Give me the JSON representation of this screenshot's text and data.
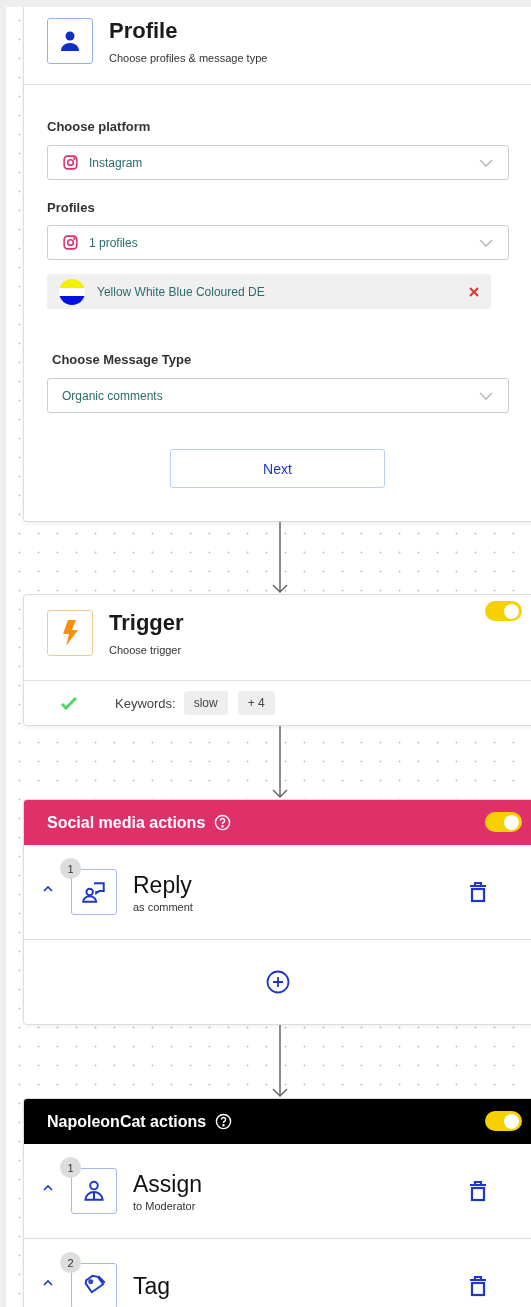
{
  "profile_step": {
    "title": "Profile",
    "subtitle": "Choose profiles & message type",
    "fields": [
      {
        "kind": "platform-select",
        "label": "Choose platform",
        "value": "Instagram"
      },
      {
        "kind": "platform-select",
        "label": "Profiles",
        "value": "1 profiles",
        "chips": [
          {
            "name": "Yellow White Blue Coloured DE"
          }
        ]
      },
      {
        "kind": "select",
        "label": "Choose Message Type",
        "value": "Organic comments"
      }
    ],
    "next_button": "Next"
  },
  "trigger_step": {
    "title": "Trigger",
    "subtitle": "Choose trigger",
    "on": true,
    "condition": {
      "done": true,
      "label": "Keywords:",
      "tags": [
        "slow",
        "+ 4"
      ]
    }
  },
  "action_groups": [
    {
      "title": "Social media actions",
      "color": "#e0306a",
      "on": true,
      "add_row": true,
      "actions": [
        {
          "kind": "reply",
          "number": "1",
          "title": "Reply",
          "subtitle": "as comment",
          "expanded": true
        }
      ]
    },
    {
      "title": "NapoleonCat actions",
      "color": "#000000",
      "on": true,
      "actions": [
        {
          "kind": "assign",
          "number": "1",
          "title": "Assign",
          "subtitle": "to Moderator",
          "expanded": true
        },
        {
          "kind": "tag",
          "number": "2",
          "title": "Tag",
          "expanded": true
        }
      ]
    }
  ]
}
